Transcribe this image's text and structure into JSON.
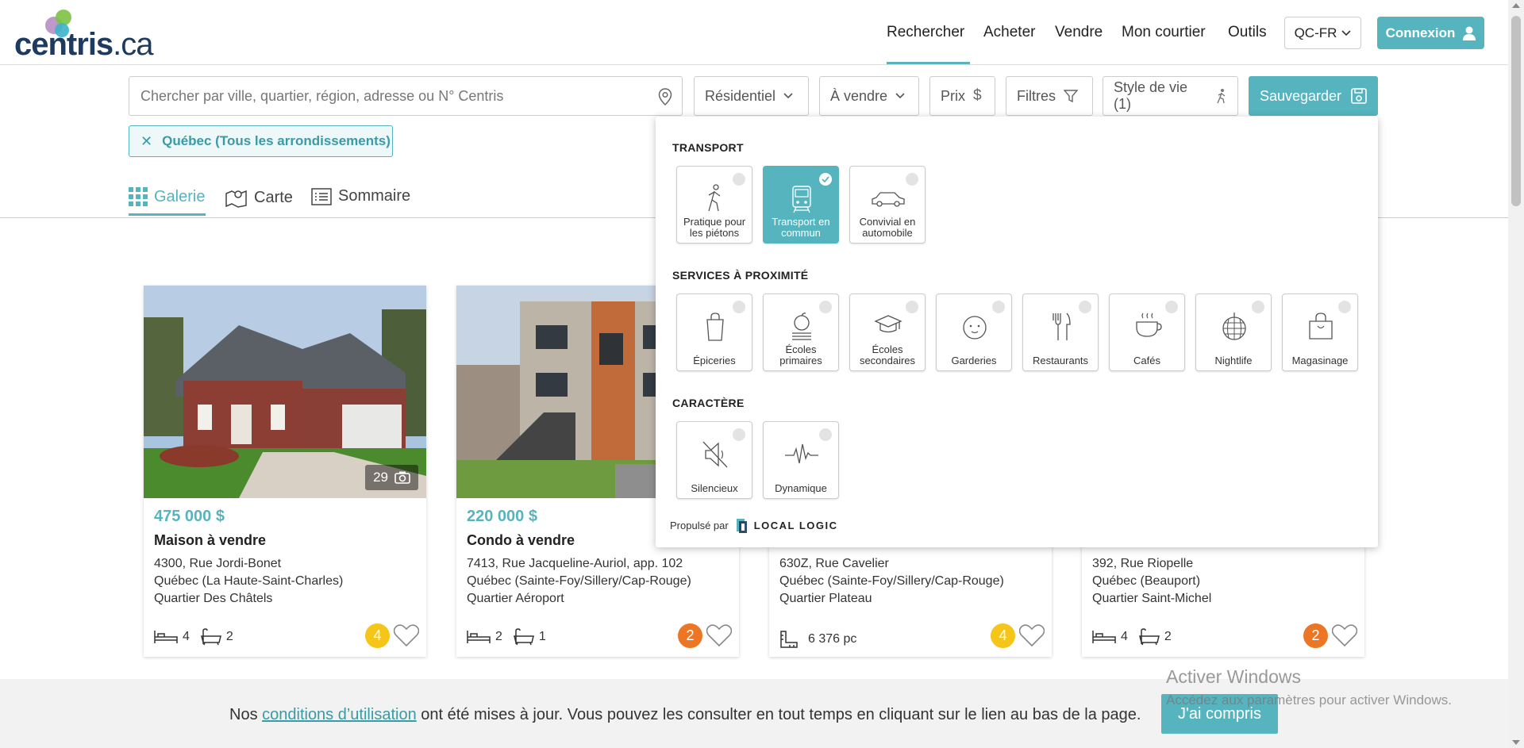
{
  "header": {
    "logo_main": "centris",
    "logo_suffix": ".ca",
    "nav": [
      "Rechercher",
      "Acheter",
      "Vendre",
      "Mon courtier",
      "Outils"
    ],
    "lang": "QC-FR",
    "login": "Connexion"
  },
  "search": {
    "placeholder": "Chercher par ville, quartier, région, adresse ou N° Centris",
    "category": "Résidentiel",
    "transaction": "À vendre",
    "price": "Prix",
    "filters": "Filtres",
    "lifestyle": "Style de vie (1)",
    "save": "Sauvegarder",
    "chip": "Québec (Tous les arrondissements)"
  },
  "views": {
    "gallery": "Galerie",
    "map": "Carte",
    "summary": "Sommaire"
  },
  "listings": [
    {
      "price": "475 000 $",
      "type": "Maison à vendre",
      "addr1": "4300, Rue Jordi-Bonet",
      "addr2": "Québec (La Haute-Saint-Charles)",
      "addr3": "Quartier Des Châtels",
      "beds": "4",
      "baths": "2",
      "score": "4",
      "photos": "29"
    },
    {
      "price": "220 000 $",
      "type": "Condo à vendre",
      "addr1": "7413, Rue Jacqueline-Auriol, app. 102",
      "addr2": "Québec (Sainte-Foy/Sillery/Cap-Rouge)",
      "addr3": "Quartier Aéroport",
      "beds": "2",
      "baths": "1",
      "score": "2"
    },
    {
      "addr1": "630Z, Rue Cavelier",
      "addr2": "Québec (Sainte-Foy/Sillery/Cap-Rouge)",
      "addr3": "Quartier Plateau",
      "area": "6 376 pc",
      "score": "4"
    },
    {
      "addr1": "392, Rue Riopelle",
      "addr2": "Québec (Beauport)",
      "addr3": "Quartier Saint-Michel",
      "beds": "4",
      "baths": "2",
      "score": "2"
    }
  ],
  "lifestyle_popup": {
    "transport_title": "TRANSPORT",
    "transport": [
      {
        "label1": "Pratique pour",
        "label2": "les piétons",
        "selected": false
      },
      {
        "label1": "Transport en",
        "label2": "commun",
        "selected": true
      },
      {
        "label1": "Convivial en",
        "label2": "automobile",
        "selected": false
      }
    ],
    "services_title": "SERVICES À PROXIMITÉ",
    "services": [
      {
        "label1": "Épiceries",
        "label2": ""
      },
      {
        "label1": "Écoles",
        "label2": "primaires"
      },
      {
        "label1": "Écoles",
        "label2": "secondaires"
      },
      {
        "label1": "Garderies",
        "label2": ""
      },
      {
        "label1": "Restaurants",
        "label2": ""
      },
      {
        "label1": "Cafés",
        "label2": ""
      },
      {
        "label1": "Nightlife",
        "label2": ""
      },
      {
        "label1": "Magasinage",
        "label2": ""
      }
    ],
    "character_title": "CARACTÈRE",
    "character": [
      {
        "label1": "Silencieux",
        "label2": ""
      },
      {
        "label1": "Dynamique",
        "label2": ""
      }
    ],
    "powered_by": "Propulsé par",
    "powered_brand": "LOCAL LOGIC"
  },
  "cookie": {
    "before": "Nos ",
    "link": "conditions d’utilisation",
    "after": " ont été mises à jour. Vous pouvez les consulter en tout temps en cliquant sur le lien au bas de la page.",
    "button": "J'ai compris"
  },
  "watermark": {
    "title": "Activer Windows",
    "subtitle": "Accédez aux paramètres pour activer Windows."
  },
  "colors": {
    "accent": "#56b4bf",
    "badge_yellow": "#f5c518",
    "badge_orange": "#ec7623"
  }
}
